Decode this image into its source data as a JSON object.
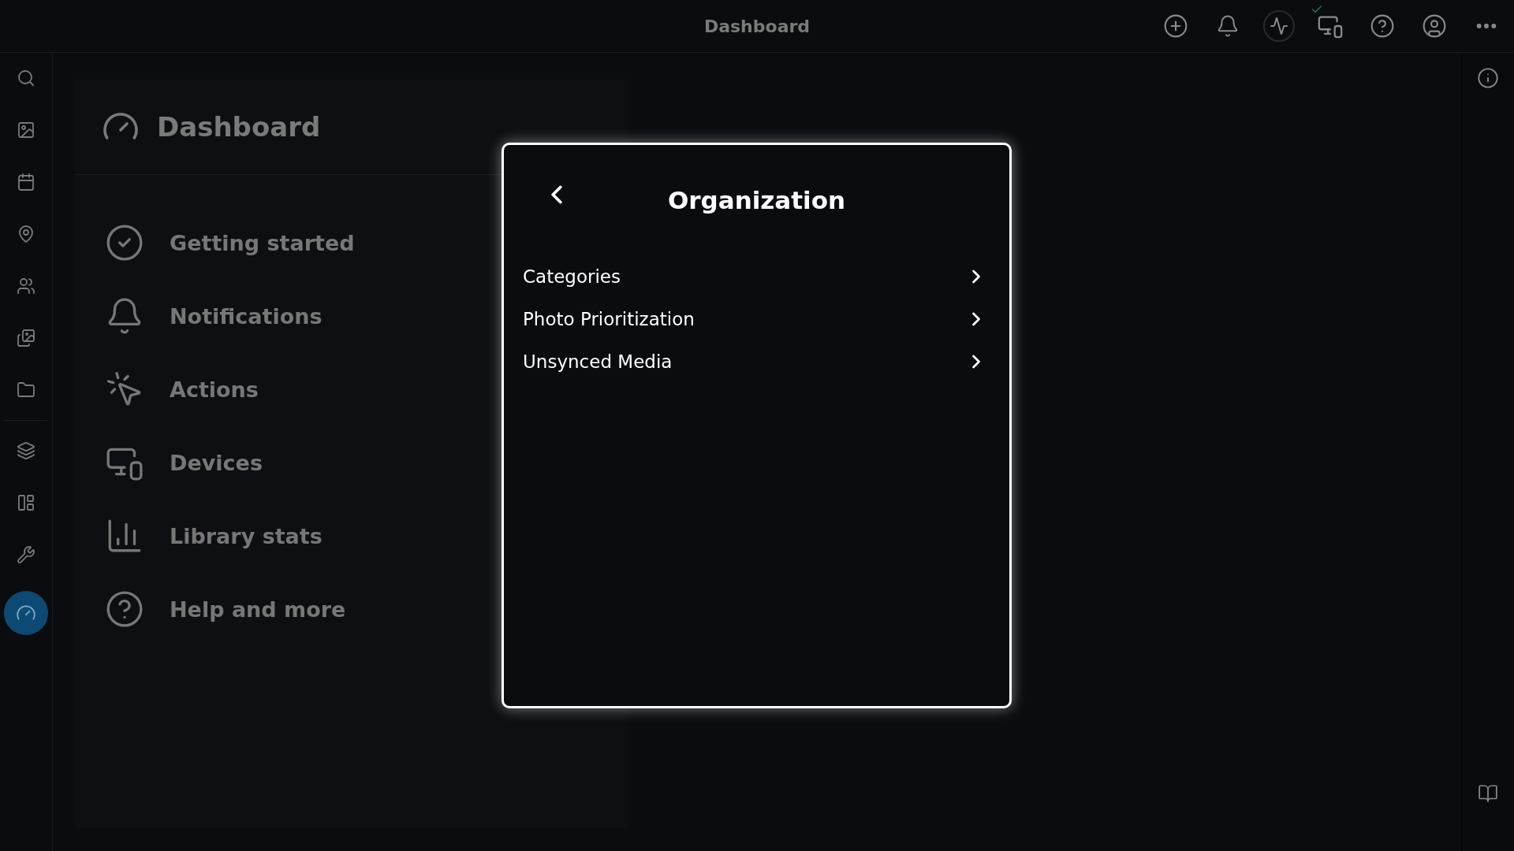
{
  "top_bar": {
    "title": "Dashboard"
  },
  "nav_rail": {
    "items": [
      {
        "selected": false
      },
      {
        "selected": false
      },
      {
        "selected": false
      },
      {
        "selected": false
      },
      {
        "selected": false
      },
      {
        "selected": false
      },
      {
        "selected": false
      },
      {
        "selected": false
      },
      {
        "selected": false
      },
      {
        "selected": false
      },
      {
        "selected": true
      }
    ]
  },
  "dashboard_panel": {
    "title": "Dashboard",
    "items": [
      {
        "label": "Getting started"
      },
      {
        "label": "Notifications"
      },
      {
        "label": "Actions"
      },
      {
        "label": "Devices"
      },
      {
        "label": "Library stats"
      },
      {
        "label": "Help and more"
      }
    ]
  },
  "dialog": {
    "title": "Organization",
    "items": [
      {
        "label": "Categories"
      },
      {
        "label": "Photo Prioritization"
      },
      {
        "label": "Unsynced Media"
      }
    ]
  }
}
